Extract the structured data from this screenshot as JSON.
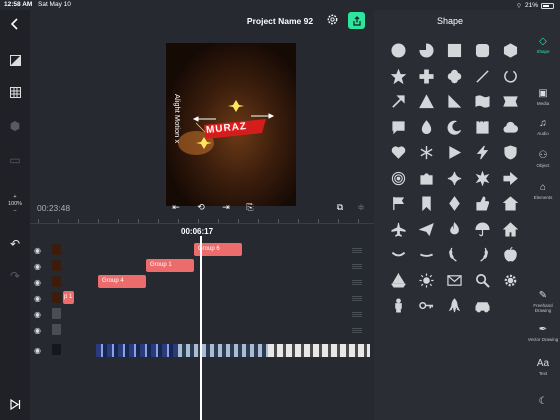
{
  "status": {
    "time": "12:58 AM",
    "date": "Sat May 10",
    "battery": "21%"
  },
  "header": {
    "project_title": "Project Name 92"
  },
  "left_toolbar": {
    "zoom_label": "100%"
  },
  "preview": {
    "logo_text": "MURAZ",
    "side_text": "Alight Motion x"
  },
  "transport": {
    "timecode": "00:23:48",
    "playhead_time": "00:06:17"
  },
  "timeline": {
    "clips": [
      {
        "label": "Group 6"
      },
      {
        "label": "Group 1"
      },
      {
        "label": "Group 4"
      },
      {
        "label": "p 1"
      }
    ]
  },
  "shape_panel": {
    "title": "Shape",
    "shapes": [
      "circle",
      "pie",
      "square",
      "rounded-square",
      "hexagon",
      "star",
      "plus",
      "flower",
      "line",
      "arc",
      "arrow",
      "triangle-filled",
      "triangle",
      "wave-flag",
      "ribbon",
      "speech-bubble",
      "drop",
      "crescent",
      "stamp",
      "cloud",
      "heart",
      "snowflake",
      "play",
      "lightning",
      "shield",
      "spiral",
      "puzzle",
      "sparkle",
      "starburst",
      "arrow-right",
      "flag",
      "bookmark",
      "diamond",
      "thumbs-up",
      "home",
      "airplane",
      "paper-plane",
      "fire",
      "umbrella",
      "house",
      "smile",
      "dash",
      "laurel-left",
      "laurel-right",
      "apple",
      "sailboat",
      "sun",
      "envelope",
      "magnifier",
      "gear-shape",
      "person",
      "key",
      "rocket",
      "car"
    ]
  },
  "categories": [
    {
      "label": "Shape",
      "icon": "shapes-icon",
      "active": true
    },
    {
      "label": "Media",
      "icon": "media-icon",
      "active": false
    },
    {
      "label": "Audio",
      "icon": "audio-icon",
      "active": false
    },
    {
      "label": "Object",
      "icon": "object-icon",
      "active": false
    },
    {
      "label": "Elements",
      "icon": "elements-icon",
      "active": false
    },
    {
      "label": "Freehand Drawing",
      "icon": "freehand-icon",
      "active": false
    },
    {
      "label": "Vector Drawing",
      "icon": "vector-icon",
      "active": false
    },
    {
      "label": "Text",
      "icon": "text-icon",
      "active": false
    }
  ],
  "colors": {
    "accent": "#2ee59d",
    "clip": "#ec6b6b",
    "background": "#26292f",
    "panel": "#2a2d33"
  }
}
